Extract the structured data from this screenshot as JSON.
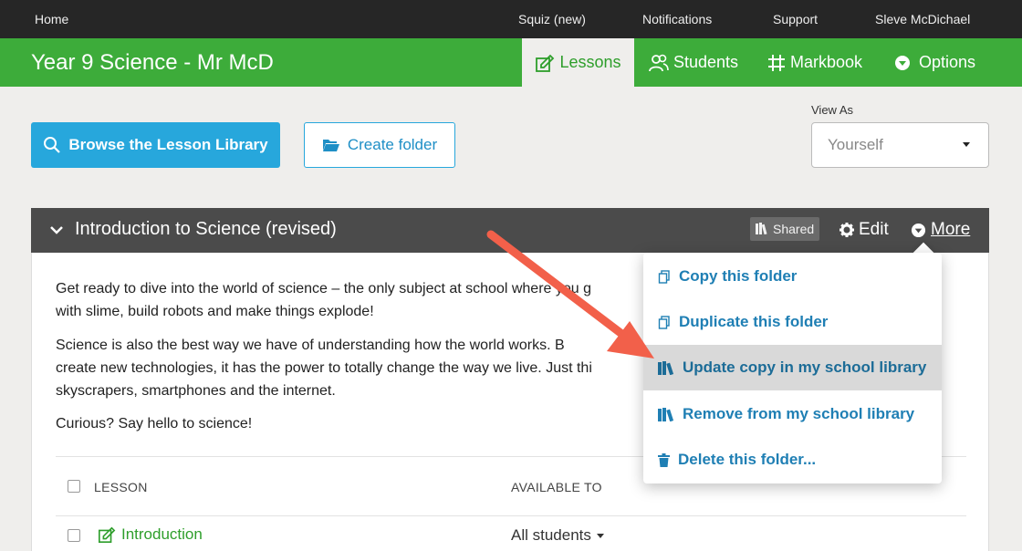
{
  "topnav": {
    "home": "Home",
    "squiz": "Squiz (new)",
    "notifications": "Notifications",
    "support": "Support",
    "user": "Sleve McDichael"
  },
  "classbar": {
    "title": "Year 9 Science - Mr McD",
    "tabs": [
      {
        "label": "Lessons",
        "icon": "lesson-icon",
        "active": true
      },
      {
        "label": "Students",
        "icon": "students-icon"
      },
      {
        "label": "Markbook",
        "icon": "grid-icon"
      },
      {
        "label": "Options",
        "icon": "chevron-circle-icon"
      }
    ]
  },
  "actions": {
    "browse_label": "Browse the Lesson Library",
    "create_folder_label": "Create folder",
    "view_as_label": "View As",
    "view_as_value": "Yourself"
  },
  "folder": {
    "title": "Introduction to Science (revised)",
    "shared_badge": "Shared",
    "edit_label": "Edit",
    "more_label": "More",
    "description": [
      "Get ready to dive into the world of science – the only subject at school where you g",
      "with slime, build robots and make things explode!",
      "Science is also the best way we have of understanding how the world works. B",
      "create new technologies, it has the power to totally change the way we live. Just thi",
      "skyscrapers, smartphones and the internet.",
      "Curious? Say hello to science!"
    ],
    "table": {
      "headers": {
        "lesson": "LESSON",
        "available_to": "AVAILABLE TO"
      },
      "rows": [
        {
          "lesson": "Introduction",
          "available_to": "All students"
        }
      ]
    }
  },
  "more_menu": {
    "items": [
      {
        "label": "Copy this folder",
        "icon": "copy-icon"
      },
      {
        "label": "Duplicate this folder",
        "icon": "copy-icon"
      },
      {
        "label": "Update copy in my school library",
        "icon": "library-icon",
        "hover": true
      },
      {
        "label": "Remove from my school library",
        "icon": "library-icon"
      },
      {
        "label": "Delete this folder...",
        "icon": "trash-icon"
      }
    ]
  },
  "colors": {
    "header_green": "#3dac3a",
    "topbar": "#262626",
    "primary_blue": "#27a7dc",
    "folder_header": "#4b4b4b",
    "link_blue": "#1f7fb4",
    "annotation_arrow": "#f2604a"
  }
}
